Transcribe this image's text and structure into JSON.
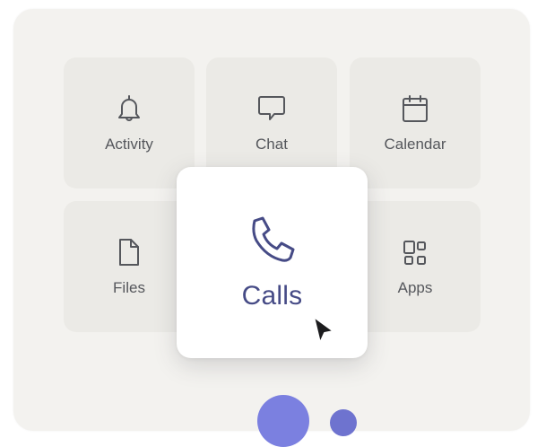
{
  "tiles": {
    "activity": {
      "label": "Activity",
      "icon": "bell-icon"
    },
    "chat": {
      "label": "Chat",
      "icon": "chat-icon"
    },
    "calendar": {
      "label": "Calendar",
      "icon": "calendar-icon"
    },
    "files": {
      "label": "Files",
      "icon": "file-icon"
    },
    "apps": {
      "label": "Apps",
      "icon": "apps-icon"
    }
  },
  "calls_card": {
    "label": "Calls",
    "icon": "phone-icon"
  },
  "colors": {
    "panel": "#f3f2ef",
    "tile": "#ebeae6",
    "tile_text": "#55575c",
    "accent": "#464b86",
    "dock_accent": "#7b80e0"
  }
}
